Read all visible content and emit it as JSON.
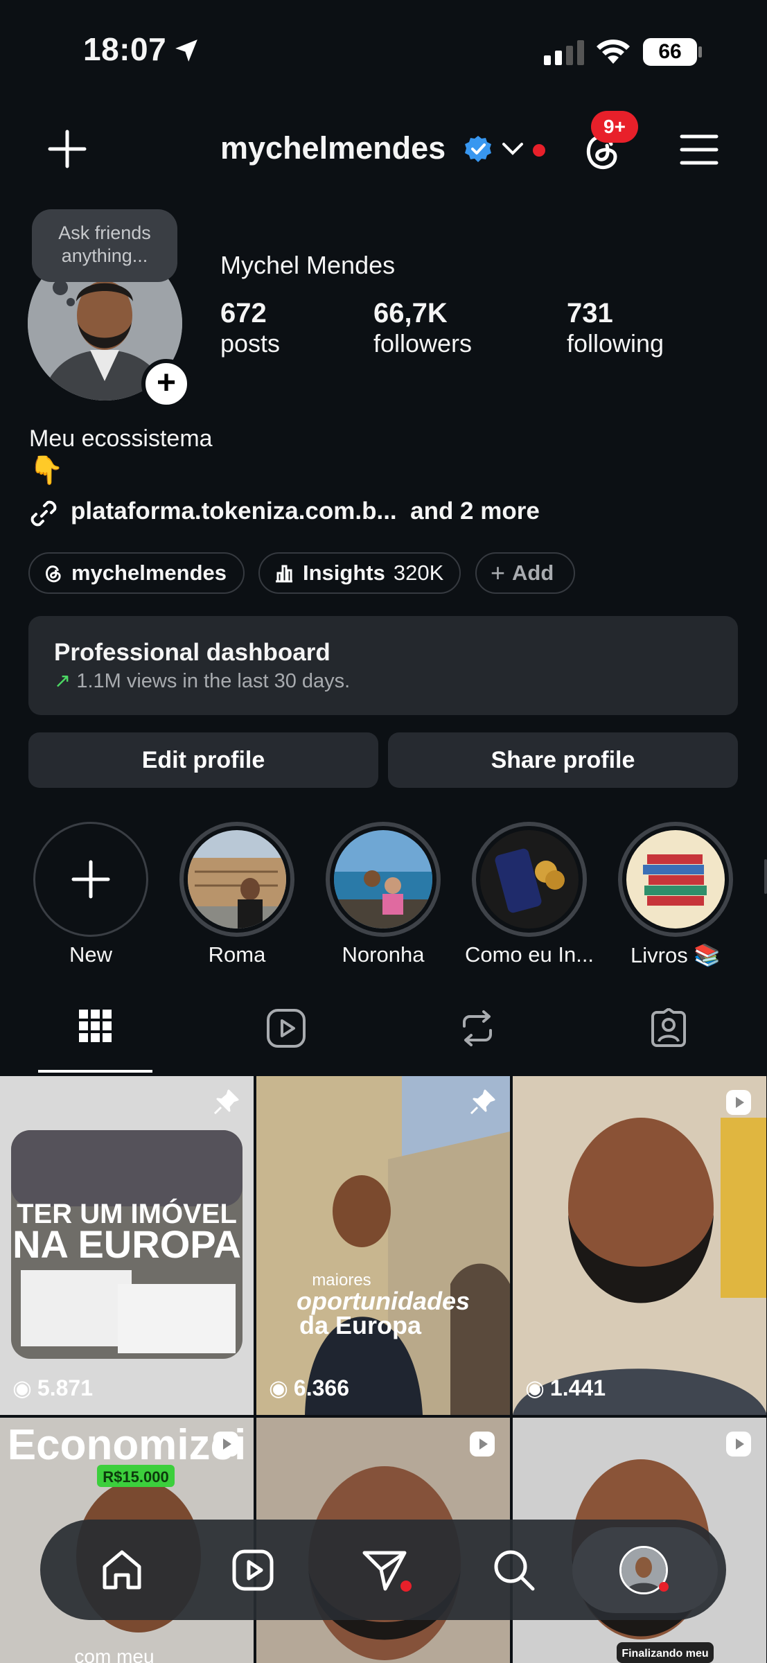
{
  "status_bar": {
    "time": "18:07",
    "battery": "66"
  },
  "header": {
    "username": "mychelmendes",
    "threads_badge": "9+"
  },
  "profile": {
    "prompt_bubble": "Ask friends anything...",
    "full_name": "Mychel Mendes",
    "stats": [
      {
        "value": "672",
        "label": "posts"
      },
      {
        "value": "66,7K",
        "label": "followers"
      },
      {
        "value": "731",
        "label": "following"
      }
    ],
    "bio_line1": "Meu ecossistema",
    "bio_emoji": "👇",
    "link_text": "plataforma.tokeniza.com.b...",
    "link_more": "and 2 more"
  },
  "pills": {
    "threads": "mychelmendes",
    "insights_label": "Insights",
    "insights_value": "320K",
    "add": "Add"
  },
  "dashboard": {
    "title": "Professional dashboard",
    "subtitle": "1.1M views in the last 30 days."
  },
  "buttons": {
    "edit": "Edit profile",
    "share": "Share profile"
  },
  "highlights": [
    {
      "label": "New"
    },
    {
      "label": "Roma"
    },
    {
      "label": "Noronha"
    },
    {
      "label": "Como eu In..."
    },
    {
      "label": "Livros 📚"
    }
  ],
  "grid": [
    {
      "views": "5.871",
      "overlay": "TER UM IMÓVEL NA EUROPA",
      "overlay1": "TER UM IMÓVEL",
      "overlay2": "NA EUROPA",
      "pinned": true
    },
    {
      "views": "6.366",
      "overlay1": "maiores",
      "overlay2": "oportunidades",
      "overlay3": "da Europa",
      "pinned": true
    },
    {
      "views": "1.441"
    },
    {
      "overlay1": "Economizei",
      "overlay2": "R$15.000"
    },
    {},
    {
      "overlay1": "Finalizando meu"
    }
  ],
  "grid_row2_caption": "com meu"
}
